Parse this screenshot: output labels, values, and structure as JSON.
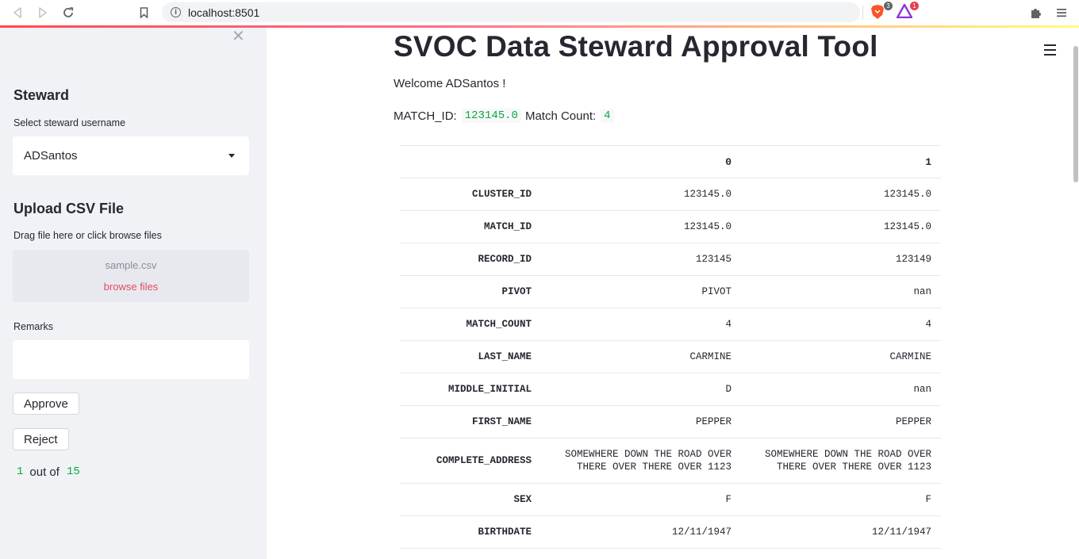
{
  "browser": {
    "url": "localhost:8501",
    "brave_badge": "3",
    "alert_badge": "1"
  },
  "sidebar": {
    "steward_heading": "Steward",
    "select_label": "Select steward username",
    "selected_username": "ADSantos",
    "upload_heading": "Upload CSV File",
    "upload_label": "Drag file here or click browse files",
    "uploaded_file": "sample.csv",
    "browse_label": "browse files",
    "remarks_label": "Remarks",
    "remarks_value": "",
    "approve_label": "Approve",
    "reject_label": "Reject",
    "progress": {
      "current": "1",
      "separator": "out of",
      "total": "15"
    }
  },
  "main": {
    "title": "SVOC Data Steward Approval Tool",
    "welcome": "Welcome ADSantos !",
    "match_id_label": "MATCH_ID:",
    "match_id_value": "123145.0",
    "match_count_label": "Match Count:",
    "match_count_value": "4",
    "table": {
      "columns": [
        "",
        "0",
        "1"
      ],
      "rows": [
        {
          "field": "CLUSTER_ID",
          "c0": "123145.0",
          "c1": "123145.0"
        },
        {
          "field": "MATCH_ID",
          "c0": "123145.0",
          "c1": "123145.0"
        },
        {
          "field": "RECORD_ID",
          "c0": "123145",
          "c1": "123149"
        },
        {
          "field": "PIVOT",
          "c0": "PIVOT",
          "c1": "nan"
        },
        {
          "field": "MATCH_COUNT",
          "c0": "4",
          "c1": "4"
        },
        {
          "field": "LAST_NAME",
          "c0": "CARMINE",
          "c1": "CARMINE"
        },
        {
          "field": "MIDDLE_INITIAL",
          "c0": "D",
          "c1": "nan"
        },
        {
          "field": "FIRST_NAME",
          "c0": "PEPPER",
          "c1": "PEPPER"
        },
        {
          "field": "COMPLETE_ADDRESS",
          "c0": "SOMEWHERE DOWN THE ROAD OVER THERE OVER THERE OVER 1123",
          "c1": "SOMEWHERE DOWN THE ROAD OVER THERE OVER THERE OVER 1123"
        },
        {
          "field": "SEX",
          "c0": "F",
          "c1": "F"
        },
        {
          "field": "BIRTHDATE",
          "c0": "12/11/1947",
          "c1": "12/11/1947"
        }
      ]
    }
  },
  "colors": {
    "sidebar_bg": "#f0f2f6",
    "code_green": "#09ab3b",
    "link_red": "#e8485e",
    "text": "#262730"
  }
}
